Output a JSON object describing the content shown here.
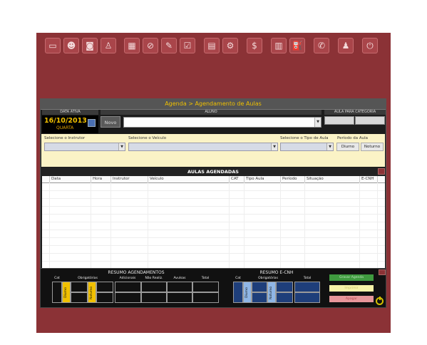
{
  "toolbar": {
    "icons": [
      {
        "name": "monitor-icon",
        "glyph": "▭"
      },
      {
        "name": "users-icon",
        "glyph": "☻"
      },
      {
        "name": "car-icon",
        "glyph": "◙"
      },
      {
        "name": "instructor-icon",
        "glyph": "♙"
      },
      {
        "name": "calendar-23-icon",
        "glyph": "▦"
      },
      {
        "name": "calendar-cancel-icon",
        "glyph": "⊘"
      },
      {
        "name": "calendar-edit-icon",
        "glyph": "✎"
      },
      {
        "name": "checklist-icon",
        "glyph": "☑"
      },
      {
        "name": "documents-icon",
        "glyph": "▤"
      },
      {
        "name": "gear-icon",
        "glyph": "⚙"
      },
      {
        "name": "money-icon",
        "glyph": "$"
      },
      {
        "name": "cash-register-icon",
        "glyph": "▥"
      },
      {
        "name": "fuel-pump-icon",
        "glyph": "⛽"
      },
      {
        "name": "phone-icon",
        "glyph": "✆"
      },
      {
        "name": "user-icon",
        "glyph": "♟"
      },
      {
        "name": "power-icon",
        "glyph": "⏻"
      }
    ]
  },
  "panel": {
    "title": "Agenda > Agendamento de Aulas",
    "data_ativa_label": "DATA ATIVA",
    "date": "16/10/2013",
    "weekday": "QUARTA",
    "aluno_label": "ALUNO",
    "novo_button": "Novo",
    "aluno_value": "",
    "aula_categoria_label": "AULA PARA CATEGORIA"
  },
  "filters": {
    "instrutor_label": "Selecione o Instrutor",
    "veiculo_label": "Selecione o Veículo",
    "tipo_label": "Selecione o Tipo de Aula",
    "periodo_label": "Período da Aula",
    "diurno": "Diurno",
    "noturno": "Noturno"
  },
  "aulas": {
    "title": "AULAS AGENDADAS",
    "columns": [
      "Data",
      "Hora",
      "Instrutor",
      "Veículo",
      "CAT",
      "Tipo Aula",
      "Período",
      "Situação",
      "E-CNH"
    ]
  },
  "resumo_agendamentos": {
    "title": "RESUMO AGENDAMENTOS",
    "cols": [
      "Cat",
      "Obrigatórias",
      "Adicionais",
      "Não Realiz.",
      "Avulsas",
      "Total"
    ],
    "diurno": "Diurno",
    "noturno": "Noturno"
  },
  "resumo_ecnh": {
    "title": "RESUMO E-CNH",
    "cols": [
      "Cat",
      "Obrigatórias",
      "Total"
    ],
    "diurno": "Diurno",
    "noturno": "Noturno"
  },
  "actions": {
    "gravar": "Gravar Agenda",
    "imprimir": "Imprimir",
    "apagar": "Apagar"
  },
  "colors": {
    "background": "#8b3236",
    "accent": "#f0c000",
    "yellow_marker": "#f0c000",
    "blue_marker": "#8fb6e6"
  }
}
